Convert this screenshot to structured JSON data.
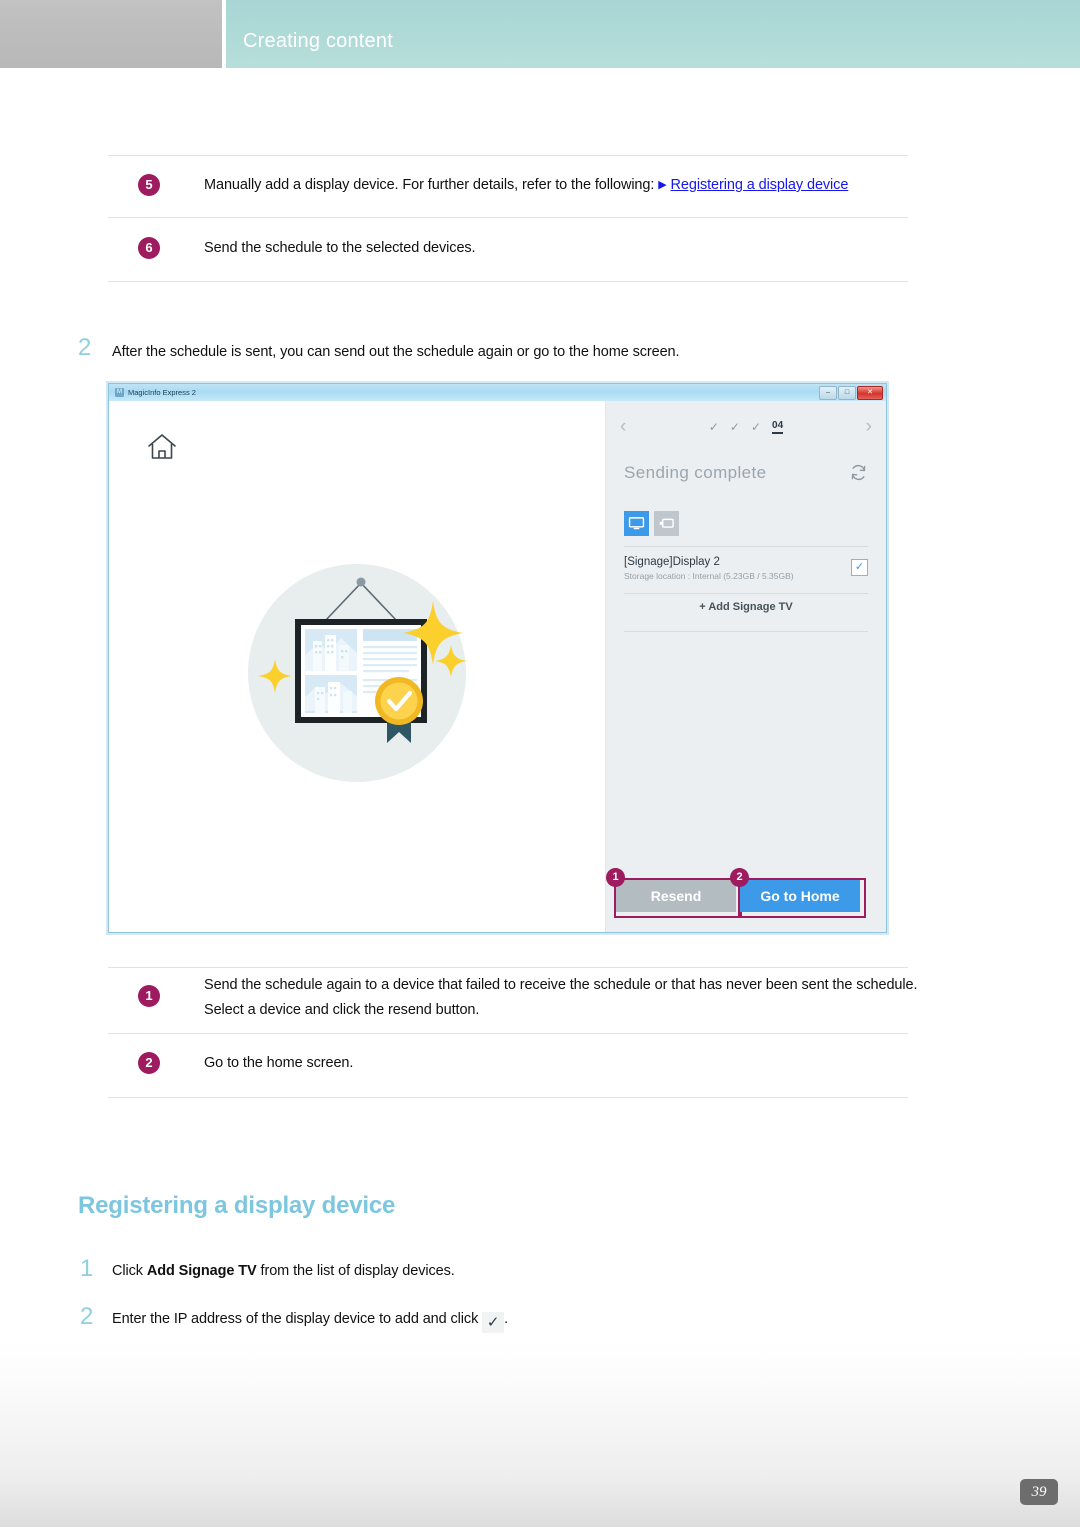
{
  "header": {
    "title": "Creating content"
  },
  "top_list": {
    "items": [
      {
        "num": "5",
        "text": "Manually add a display device. For further details, refer to the following:",
        "link": "Registering a display device"
      },
      {
        "num": "6",
        "text": "Send the schedule to the selected devices.",
        "link": ""
      }
    ]
  },
  "step2": {
    "number": "2",
    "text": "After the schedule is sent, you can send out the schedule again or go to the home screen."
  },
  "app": {
    "titlebar": {
      "title": "MagicInfo Express 2",
      "minimize": "–",
      "maximize": "□",
      "close": "✕"
    },
    "home_icon": "home-icon",
    "nav": {
      "prev": "‹",
      "next": "›",
      "completed_steps": [
        "✓",
        "✓",
        "✓"
      ],
      "current_step": "04"
    },
    "panel": {
      "title": "Sending complete",
      "refresh_icon": "refresh-icon",
      "device_types": [
        {
          "name": "monitor-icon",
          "selected": true
        },
        {
          "name": "usb-icon",
          "selected": false
        }
      ],
      "device": {
        "name": "[Signage]Display 2",
        "storage": "Storage location : Internal (5.23GB / 5.35GB)",
        "checked": "✓"
      },
      "add_device": "+  Add Signage TV"
    },
    "buttons": {
      "resend": "Resend",
      "go_home": "Go to Home",
      "callout_1": "1",
      "callout_2": "2"
    }
  },
  "bottom_list": {
    "items": [
      {
        "num": "1",
        "text": "Send the schedule again to a device that failed to receive the schedule or that has never been sent the schedule. Select a device and click the resend button."
      },
      {
        "num": "2",
        "text": "Go to the home screen."
      }
    ]
  },
  "section": {
    "title": "Registering a display device",
    "steps": [
      {
        "number": "1",
        "pre": "Click ",
        "bold": "Add Signage TV",
        "post": " from the list of display devices."
      },
      {
        "number": "2",
        "pre": "Enter the IP address of the display device to add and click ",
        "bold": "",
        "post": "."
      }
    ],
    "check_glyph": "✓"
  },
  "page_number": "39",
  "colors": {
    "header_teal": "#add9d6",
    "badge_magenta": "#9d1b5e",
    "accent_blue": "#3d9ae8",
    "link_blue": "#1717ee",
    "heading_blue": "#7cc6e0"
  }
}
